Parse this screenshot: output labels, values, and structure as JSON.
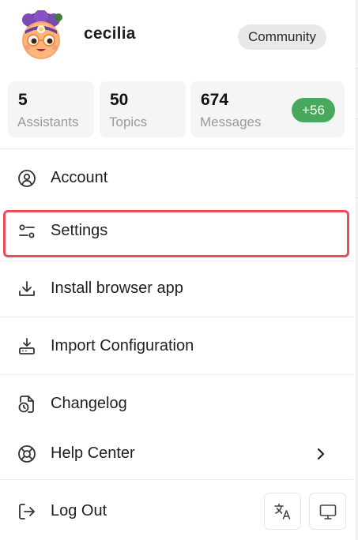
{
  "user": {
    "name": "cecilia",
    "plan_badge": "Community"
  },
  "stats": [
    {
      "value": "5",
      "label": "Assistants"
    },
    {
      "value": "50",
      "label": "Topics"
    },
    {
      "value": "674",
      "label": "Messages",
      "delta": "+56"
    }
  ],
  "menu": {
    "account": "Account",
    "settings": "Settings",
    "install": "Install browser app",
    "import": "Import Configuration",
    "changelog": "Changelog",
    "help": "Help Center",
    "logout": "Log Out"
  },
  "icons": {
    "account": "user-circle-icon",
    "settings": "sliders-icon",
    "install": "download-icon",
    "import": "hard-drive-download-icon",
    "changelog": "file-clock-icon",
    "help": "lifebuoy-icon",
    "logout": "log-out-icon",
    "language": "language-icon",
    "theme": "monitor-icon"
  },
  "colors": {
    "highlight": "#ef4b55",
    "delta_badge": "#48a95c",
    "badge_bg": "#e8e8e8"
  }
}
